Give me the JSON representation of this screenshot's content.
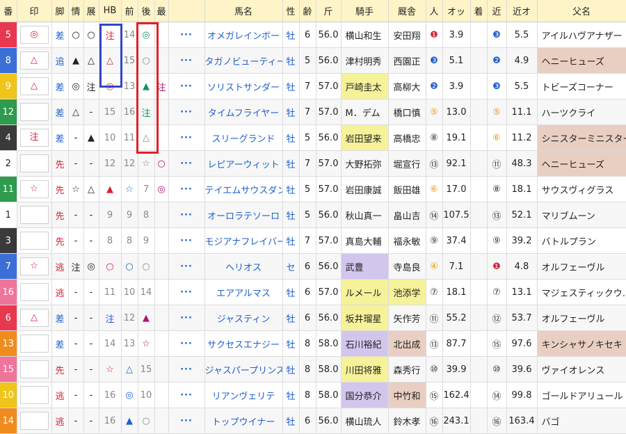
{
  "headers": [
    "番",
    "印",
    "脚",
    "情",
    "展",
    "HB",
    "前",
    "後",
    "最",
    "",
    "馬名",
    "性",
    "齢",
    "斤",
    "騎手",
    "厩舎",
    "人",
    "オッ",
    "着",
    "近",
    "近オ",
    "父名"
  ],
  "colors": {
    "header_bg": "#fff4c8",
    "blue_box": "#3346c8",
    "red_box": "#e0202a"
  },
  "rows": [
    {
      "num": "5",
      "num_bg": "#e8384f",
      "mark": "◎",
      "kyaku": "差",
      "jou": "○",
      "ten": "○",
      "hb": "注",
      "hb_c": "red",
      "mae": "14",
      "mae_c": "gray",
      "ato": "◎",
      "ato_c": "green",
      "sai": "",
      "sai_c": "",
      "dots": "···",
      "name": "オメガレインボー",
      "sex": "牡",
      "age": "6",
      "kin": "56.0",
      "jockey": "横山和生",
      "jockey_bg": "",
      "stable": "安田翔",
      "stable_bg": "",
      "pop": "❶",
      "pop_c": "red",
      "odds": "3.9",
      "chaku": "",
      "kin_rank": "❸",
      "kin_rank_c": "blue",
      "kin_odds": "5.5",
      "father": "アイルハヴアナザー",
      "father_bg": ""
    },
    {
      "num": "8",
      "num_bg": "#3a6fd8",
      "mark": "△",
      "kyaku": "追",
      "jou": "▲",
      "ten": "△",
      "hb": "△",
      "hb_c": "red",
      "mae": "15",
      "mae_c": "gray",
      "ato": "○",
      "ato_c": "gray",
      "sai": "",
      "sai_c": "",
      "dots": "···",
      "name": "タガノビューティー",
      "sex": "牡",
      "age": "5",
      "kin": "56.0",
      "jockey": "津村明秀",
      "jockey_bg": "",
      "stable": "西園正",
      "stable_bg": "",
      "pop": "❸",
      "pop_c": "blue",
      "odds": "5.1",
      "chaku": "",
      "kin_rank": "❷",
      "kin_rank_c": "blue",
      "kin_odds": "4.9",
      "father": "ヘニーヒューズ",
      "father_bg": "#e9cfc2"
    },
    {
      "num": "9",
      "num_bg": "#f0c419",
      "mark": "△",
      "kyaku": "差",
      "jou": "◎",
      "ten": "注",
      "hb": "◎",
      "hb_c": "red",
      "mae": "13",
      "mae_c": "gray",
      "ato": "▲",
      "ato_c": "green",
      "sai": "注",
      "sai_c": "magenta",
      "dots": "···",
      "name": "ソリストサンダー",
      "sex": "牡",
      "age": "7",
      "kin": "57.0",
      "jockey": "戸崎圭太",
      "jockey_bg": "#f6f29a",
      "stable": "高柳大",
      "stable_bg": "",
      "pop": "❷",
      "pop_c": "blue",
      "odds": "3.9",
      "chaku": "",
      "kin_rank": "❸",
      "kin_rank_c": "blue",
      "kin_odds": "5.5",
      "father": "トビーズコーナー",
      "father_bg": ""
    },
    {
      "num": "12",
      "num_bg": "#2e9b4e",
      "mark": "",
      "kyaku": "差",
      "jou": "△",
      "ten": "-",
      "hb": "15",
      "hb_c": "gray",
      "mae": "16",
      "mae_c": "gray",
      "ato": "注",
      "ato_c": "green",
      "sai": "",
      "sai_c": "",
      "dots": "···",
      "name": "タイムフライヤー",
      "sex": "牡",
      "age": "7",
      "kin": "57.0",
      "jockey": "M．デム",
      "jockey_bg": "",
      "stable": "橋口慎",
      "stable_bg": "",
      "pop": "⑤",
      "pop_c": "orange",
      "odds": "13.0",
      "chaku": "",
      "kin_rank": "⑤",
      "kin_rank_c": "orange",
      "kin_odds": "11.1",
      "father": "ハーツクライ",
      "father_bg": ""
    },
    {
      "num": "4",
      "num_bg": "#3a3a3a",
      "mark": "注",
      "kyaku": "差",
      "jou": "-",
      "ten": "▲",
      "hb": "10",
      "hb_c": "gray",
      "mae": "11",
      "mae_c": "gray",
      "ato": "△",
      "ato_c": "gray",
      "sai": "",
      "sai_c": "",
      "dots": "···",
      "name": "スリーグランド",
      "sex": "牡",
      "age": "5",
      "kin": "56.0",
      "jockey": "岩田望来",
      "jockey_bg": "#f6f29a",
      "stable": "高橋忠",
      "stable_bg": "",
      "pop": "⑧",
      "pop_c": "",
      "odds": "19.1",
      "chaku": "",
      "kin_rank": "⑥",
      "kin_rank_c": "orange",
      "kin_odds": "11.2",
      "father": "シニスターミニスター",
      "father_bg": "#e9cfc2"
    },
    {
      "num": "2",
      "num_bg": "#ffffff",
      "mark": "",
      "kyaku": "先",
      "jou": "-",
      "ten": "-",
      "hb": "12",
      "hb_c": "gray",
      "mae": "12",
      "mae_c": "gray",
      "ato": "☆",
      "ato_c": "gray",
      "sai": "○",
      "sai_c": "magenta",
      "dots": "···",
      "name": "レピアーウィット",
      "sex": "牡",
      "age": "7",
      "kin": "57.0",
      "jockey": "大野拓弥",
      "jockey_bg": "",
      "stable": "堀宣行",
      "stable_bg": "",
      "pop": "⑬",
      "pop_c": "",
      "odds": "92.1",
      "chaku": "",
      "kin_rank": "⑪",
      "kin_rank_c": "",
      "kin_odds": "48.3",
      "father": "ヘニーヒューズ",
      "father_bg": "#e9cfc2"
    },
    {
      "num": "11",
      "num_bg": "#2e9b4e",
      "mark": "☆",
      "kyaku": "先",
      "jou": "☆",
      "ten": "△",
      "hb": "▲",
      "hb_c": "red",
      "mae": "☆",
      "mae_c": "blue",
      "ato": "7",
      "ato_c": "gray",
      "sai": "◎",
      "sai_c": "magenta",
      "dots": "···",
      "name": "テイエムサウスダン",
      "sex": "牡",
      "age": "5",
      "kin": "57.0",
      "jockey": "岩田康誠",
      "jockey_bg": "",
      "stable": "飯田雄",
      "stable_bg": "",
      "pop": "⑥",
      "pop_c": "orange",
      "odds": "17.0",
      "chaku": "",
      "kin_rank": "⑧",
      "kin_rank_c": "",
      "kin_odds": "18.1",
      "father": "サウスヴィグラス",
      "father_bg": ""
    },
    {
      "num": "1",
      "num_bg": "#ffffff",
      "mark": "",
      "kyaku": "先",
      "jou": "-",
      "ten": "-",
      "hb": "9",
      "hb_c": "gray",
      "mae": "9",
      "mae_c": "gray",
      "ato": "8",
      "ato_c": "gray",
      "sai": "",
      "sai_c": "",
      "dots": "···",
      "name": "オーロラテソーロ",
      "sex": "牡",
      "age": "5",
      "kin": "56.0",
      "jockey": "秋山真一",
      "jockey_bg": "",
      "stable": "畠山吉",
      "stable_bg": "",
      "pop": "⑭",
      "pop_c": "",
      "odds": "107.5",
      "chaku": "",
      "kin_rank": "⑬",
      "kin_rank_c": "",
      "kin_odds": "52.1",
      "father": "マリブムーン",
      "father_bg": ""
    },
    {
      "num": "3",
      "num_bg": "#3a3a3a",
      "mark": "",
      "kyaku": "先",
      "jou": "-",
      "ten": "-",
      "hb": "8",
      "hb_c": "gray",
      "mae": "8",
      "mae_c": "gray",
      "ato": "9",
      "ato_c": "gray",
      "sai": "",
      "sai_c": "",
      "dots": "···",
      "name": "モジアナフレイバー",
      "sex": "牡",
      "age": "7",
      "kin": "57.0",
      "jockey": "真島大輔",
      "jockey_bg": "",
      "stable": "福永敏",
      "stable_bg": "",
      "pop": "⑨",
      "pop_c": "",
      "odds": "37.4",
      "chaku": "",
      "kin_rank": "⑨",
      "kin_rank_c": "",
      "kin_odds": "39.2",
      "father": "バトルプラン",
      "father_bg": ""
    },
    {
      "num": "7",
      "num_bg": "#3a6fd8",
      "mark": "☆",
      "kyaku": "逃",
      "jou": "注",
      "ten": "◎",
      "hb": "○",
      "hb_c": "red",
      "mae": "○",
      "mae_c": "blue",
      "ato": "○",
      "ato_c": "gray",
      "sai": "",
      "sai_c": "",
      "dots": "···",
      "name": "ヘリオス",
      "sex": "セ",
      "age": "6",
      "kin": "56.0",
      "jockey": "武豊",
      "jockey_bg": "#d2c6ec",
      "stable": "寺島良",
      "stable_bg": "",
      "pop": "④",
      "pop_c": "orange",
      "odds": "7.1",
      "chaku": "",
      "kin_rank": "❶",
      "kin_rank_c": "red",
      "kin_odds": "4.8",
      "father": "オルフェーヴル",
      "father_bg": ""
    },
    {
      "num": "16",
      "num_bg": "#f0739c",
      "mark": "",
      "kyaku": "逃",
      "jou": "-",
      "ten": "-",
      "hb": "11",
      "hb_c": "gray",
      "mae": "10",
      "mae_c": "gray",
      "ato": "14",
      "ato_c": "gray",
      "sai": "",
      "sai_c": "",
      "dots": "···",
      "name": "エアアルマス",
      "sex": "牡",
      "age": "6",
      "kin": "57.0",
      "jockey": "ルメール",
      "jockey_bg": "#f6f29a",
      "stable": "池添学",
      "stable_bg": "#f6f29a",
      "pop": "⑦",
      "pop_c": "",
      "odds": "18.1",
      "chaku": "",
      "kin_rank": "⑦",
      "kin_rank_c": "",
      "kin_odds": "13.1",
      "father": "マジェスティックウ…",
      "father_bg": ""
    },
    {
      "num": "6",
      "num_bg": "#e8384f",
      "mark": "△",
      "kyaku": "差",
      "jou": "-",
      "ten": "-",
      "hb": "注",
      "hb_c": "blue",
      "mae": "12",
      "mae_c": "gray",
      "ato": "▲",
      "ato_c": "magenta",
      "sai": "",
      "sai_c": "",
      "dots": "···",
      "name": "ジャスティン",
      "sex": "牡",
      "age": "6",
      "kin": "56.0",
      "jockey": "坂井瑠星",
      "jockey_bg": "#f6f29a",
      "stable": "矢作芳",
      "stable_bg": "",
      "pop": "⑪",
      "pop_c": "",
      "odds": "55.2",
      "chaku": "",
      "kin_rank": "⑫",
      "kin_rank_c": "",
      "kin_odds": "53.7",
      "father": "オルフェーヴル",
      "father_bg": ""
    },
    {
      "num": "13",
      "num_bg": "#f08c1e",
      "mark": "",
      "kyaku": "差",
      "jou": "-",
      "ten": "-",
      "hb": "14",
      "hb_c": "gray",
      "mae": "13",
      "mae_c": "gray",
      "ato": "☆",
      "ato_c": "magenta",
      "sai": "",
      "sai_c": "",
      "dots": "···",
      "name": "サクセスエナジー",
      "sex": "牡",
      "age": "8",
      "kin": "58.0",
      "jockey": "石川裕紀",
      "jockey_bg": "#d2c6ec",
      "stable": "北出成",
      "stable_bg": "#e9cfc2",
      "pop": "⑬",
      "pop_c": "",
      "odds": "87.7",
      "chaku": "",
      "kin_rank": "⑮",
      "kin_rank_c": "",
      "kin_odds": "97.6",
      "father": "キンシャサノキセキ",
      "father_bg": "#e9cfc2"
    },
    {
      "num": "15",
      "num_bg": "#f0739c",
      "mark": "",
      "kyaku": "先",
      "jou": "-",
      "ten": "-",
      "hb": "☆",
      "hb_c": "red",
      "mae": "△",
      "mae_c": "blue",
      "ato": "15",
      "ato_c": "gray",
      "sai": "",
      "sai_c": "",
      "dots": "···",
      "name": "ジャスパープリンス",
      "sex": "牡",
      "age": "8",
      "kin": "58.0",
      "jockey": "川田将雅",
      "jockey_bg": "#f6f29a",
      "stable": "森秀行",
      "stable_bg": "",
      "pop": "⑩",
      "pop_c": "",
      "odds": "39.9",
      "chaku": "",
      "kin_rank": "⑩",
      "kin_rank_c": "",
      "kin_odds": "39.6",
      "father": "ヴァイオレンス",
      "father_bg": ""
    },
    {
      "num": "10",
      "num_bg": "#f0c419",
      "mark": "",
      "kyaku": "逃",
      "jou": "-",
      "ten": "-",
      "hb": "16",
      "hb_c": "gray",
      "mae": "◎",
      "mae_c": "blue",
      "ato": "10",
      "ato_c": "gray",
      "sai": "",
      "sai_c": "",
      "dots": "···",
      "name": "リアンヴェリテ",
      "sex": "牡",
      "age": "8",
      "kin": "58.0",
      "jockey": "国分恭介",
      "jockey_bg": "#d2c6ec",
      "stable": "中竹和",
      "stable_bg": "#e9cfc2",
      "pop": "⑮",
      "pop_c": "",
      "odds": "162.4",
      "chaku": "",
      "kin_rank": "⑭",
      "kin_rank_c": "",
      "kin_odds": "99.8",
      "father": "ゴールドアリュール",
      "father_bg": ""
    },
    {
      "num": "14",
      "num_bg": "#f08c1e",
      "mark": "",
      "kyaku": "逃",
      "jou": "-",
      "ten": "-",
      "hb": "16",
      "hb_c": "gray",
      "mae": "▲",
      "mae_c": "blue",
      "ato": "○",
      "ato_c": "gray",
      "sai": "",
      "sai_c": "",
      "dots": "···",
      "name": "トップウイナー",
      "sex": "牡",
      "age": "6",
      "kin": "56.0",
      "jockey": "横山琉人",
      "jockey_bg": "",
      "stable": "鈴木孝",
      "stable_bg": "",
      "pop": "⑯",
      "pop_c": "",
      "odds": "243.1",
      "chaku": "",
      "kin_rank": "⑯",
      "kin_rank_c": "",
      "kin_odds": "163.4",
      "father": "バゴ",
      "father_bg": ""
    }
  ]
}
